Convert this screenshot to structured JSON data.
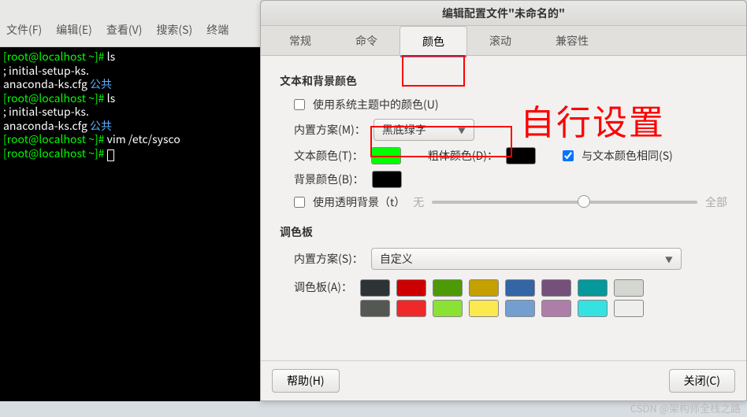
{
  "terminal": {
    "menu": [
      "文件(F)",
      "编辑(E)",
      "查看(V)",
      "搜索(S)",
      "终端"
    ],
    "lines": [
      {
        "t": "prompt",
        "user": "[root@localhost ~]# ",
        "cmd": "ls"
      },
      {
        "t": "cont",
        "text": ";               initial-setup-ks."
      },
      {
        "t": "out",
        "a": "anaconda-ks.cfg  ",
        "b": "公共"
      },
      {
        "t": "prompt",
        "user": "[root@localhost ~]# ",
        "cmd": "ls"
      },
      {
        "t": "cont",
        "text": ";               initial-setup-ks."
      },
      {
        "t": "out",
        "a": "anaconda-ks.cfg  ",
        "b": "公共"
      },
      {
        "t": "prompt",
        "user": "[root@localhost ~]# ",
        "cmd": "vim /etc/sysco"
      },
      {
        "t": "prompt",
        "user": "[root@localhost ~]# ",
        "cmd": ""
      }
    ]
  },
  "dialog": {
    "title": "编辑配置文件\"未命名的\"",
    "tabs": [
      "常规",
      "命令",
      "颜色",
      "滚动",
      "兼容性"
    ],
    "active_tab": 2,
    "section1": "文本和背景颜色",
    "use_system": "使用系统主题中的颜色(U)",
    "scheme_label": "内置方案(M)：",
    "scheme_value": "黑底绿字",
    "text_color_label": "文本颜色(T)：",
    "text_color": "#00ff00",
    "bold_color_label": "粗体颜色(D)：",
    "bold_color": "#000000",
    "same_as_text": "与文本颜色相同(S)",
    "bg_color_label": "背景颜色(B)：",
    "bg_color": "#000000",
    "use_transparent": "使用透明背景（t）",
    "slider_min": "无",
    "slider_max": "全部",
    "section2": "调色板",
    "pal_scheme_label": "内置方案(S)：",
    "pal_scheme_value": "自定义",
    "palette_label": "调色板(A)：",
    "palette": [
      [
        "#2e3436",
        "#cc0000",
        "#4e9a06",
        "#c4a000",
        "#3465a4",
        "#75507b",
        "#06989a",
        "#d3d7cf"
      ],
      [
        "#555753",
        "#ef2929",
        "#8ae234",
        "#fce94f",
        "#729fcf",
        "#ad7fa8",
        "#34e2e2",
        "#eeeeec"
      ]
    ],
    "help": "帮助(H)",
    "close": "关闭(C)"
  },
  "annotation": "自行设置",
  "watermark": "CSDN @架构师全栈之路"
}
